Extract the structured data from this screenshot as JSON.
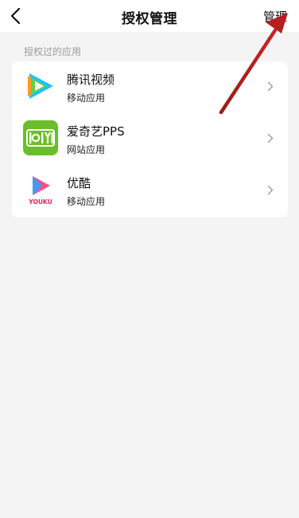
{
  "header": {
    "back_icon": "chevron-left-icon",
    "title": "授权管理",
    "manage_label": "管理"
  },
  "section": {
    "label": "授权过的应用"
  },
  "apps": [
    {
      "name": "腾讯视频",
      "type": "移动应用",
      "icon": "tencent-video-icon"
    },
    {
      "name": "爱奇艺PPS",
      "type": "网站应用",
      "icon": "iqiyi-icon"
    },
    {
      "name": "优酷",
      "type": "移动应用",
      "icon": "youku-icon",
      "icon_text": "YOUKU"
    }
  ],
  "colors": {
    "annotation_arrow": "#b01d1d",
    "iqiyi_green": "#6bbd2b",
    "youku_pink": "#ff4d8a",
    "youku_blue": "#2ea3ff"
  }
}
